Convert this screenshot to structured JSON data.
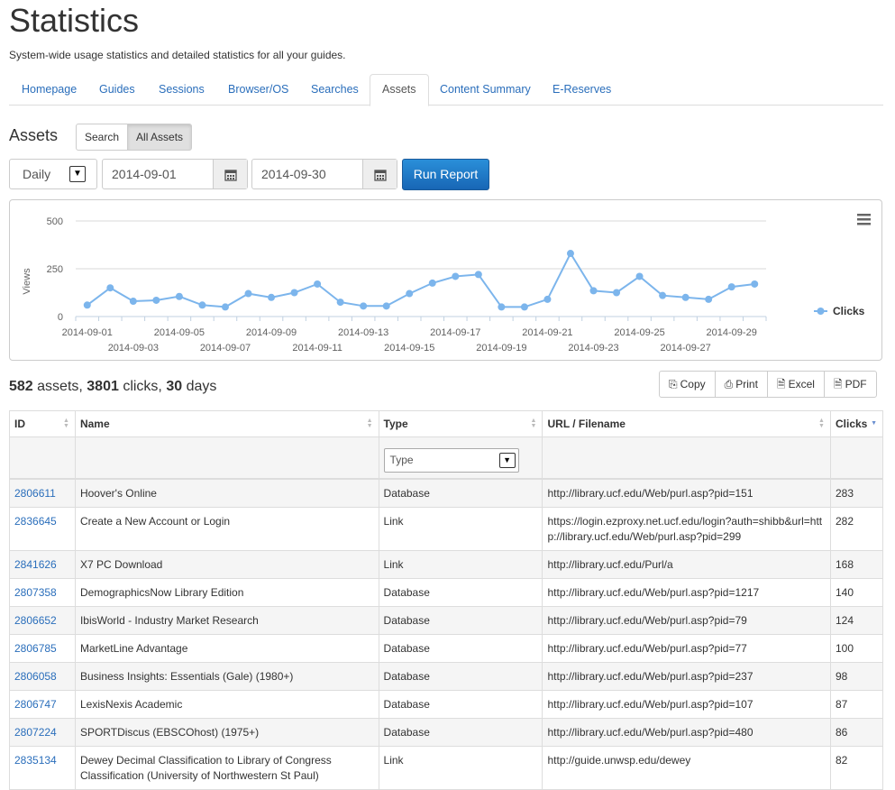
{
  "page": {
    "title": "Statistics",
    "subtitle": "System-wide usage statistics and detailed statistics for all your guides."
  },
  "tabs": [
    "Homepage",
    "Guides",
    "Sessions",
    "Browser/OS",
    "Searches",
    "Assets",
    "Content Summary",
    "E-Reserves"
  ],
  "active_tab": "Assets",
  "section": {
    "title": "Assets",
    "toggle": [
      "Search",
      "All Assets"
    ]
  },
  "filters": {
    "period": "Daily",
    "start_date": "2014-09-01",
    "end_date": "2014-09-30",
    "run_label": "Run Report"
  },
  "chart_data": {
    "type": "line",
    "ylabel": "Views",
    "ylim": [
      0,
      500
    ],
    "yticks": [
      0,
      250,
      500
    ],
    "legend": "Clicks",
    "x_labels_top": [
      "2014-09-01",
      "2014-09-05",
      "2014-09-09",
      "2014-09-13",
      "2014-09-17",
      "2014-09-21",
      "2014-09-25",
      "2014-09-29"
    ],
    "x_labels_bottom": [
      "2014-09-03",
      "2014-09-07",
      "2014-09-11",
      "2014-09-15",
      "2014-09-19",
      "2014-09-23",
      "2014-09-27"
    ],
    "x": [
      "2014-09-01",
      "2014-09-02",
      "2014-09-03",
      "2014-09-04",
      "2014-09-05",
      "2014-09-06",
      "2014-09-07",
      "2014-09-08",
      "2014-09-09",
      "2014-09-10",
      "2014-09-11",
      "2014-09-12",
      "2014-09-13",
      "2014-09-14",
      "2014-09-15",
      "2014-09-16",
      "2014-09-17",
      "2014-09-18",
      "2014-09-19",
      "2014-09-20",
      "2014-09-21",
      "2014-09-22",
      "2014-09-23",
      "2014-09-24",
      "2014-09-25",
      "2014-09-26",
      "2014-09-27",
      "2014-09-28",
      "2014-09-29",
      "2014-09-30"
    ],
    "series": [
      {
        "name": "Clicks",
        "values": [
          60,
          150,
          80,
          85,
          105,
          60,
          50,
          120,
          100,
          125,
          170,
          75,
          55,
          55,
          120,
          175,
          210,
          220,
          50,
          50,
          90,
          330,
          135,
          125,
          210,
          110,
          100,
          90,
          155,
          170
        ]
      }
    ],
    "color": "#7cb5ec",
    "legend_position": "right"
  },
  "summary": {
    "assets": "582",
    "assets_label": " assets, ",
    "clicks": "3801",
    "clicks_label": " clicks, ",
    "days": "30",
    "days_label": " days"
  },
  "exports": [
    "Copy",
    "Print",
    "Excel",
    "PDF"
  ],
  "table": {
    "headers": [
      "ID",
      "Name",
      "Type",
      "URL / Filename",
      "Clicks"
    ],
    "type_filter": "Type",
    "rows": [
      [
        "2806611",
        "Hoover's Online",
        "Database",
        "http://library.ucf.edu/Web/purl.asp?pid=151",
        "283"
      ],
      [
        "2836645",
        "Create a New Account or Login",
        "Link",
        "https://login.ezproxy.net.ucf.edu/login?auth=shibb&url=http://library.ucf.edu/Web/purl.asp?pid=299",
        "282"
      ],
      [
        "2841626",
        "X7 PC Download",
        "Link",
        "http://library.ucf.edu/Purl/a",
        "168"
      ],
      [
        "2807358",
        "DemographicsNow Library Edition",
        "Database",
        "http://library.ucf.edu/Web/purl.asp?pid=1217",
        "140"
      ],
      [
        "2806652",
        "IbisWorld - Industry Market Research",
        "Database",
        "http://library.ucf.edu/Web/purl.asp?pid=79",
        "124"
      ],
      [
        "2806785",
        "MarketLine Advantage",
        "Database",
        "http://library.ucf.edu/Web/purl.asp?pid=77",
        "100"
      ],
      [
        "2806058",
        "Business Insights: Essentials (Gale) (1980+)",
        "Database",
        "http://library.ucf.edu/Web/purl.asp?pid=237",
        "98"
      ],
      [
        "2806747",
        "LexisNexis Academic",
        "Database",
        "http://library.ucf.edu/Web/purl.asp?pid=107",
        "87"
      ],
      [
        "2807224",
        "SPORTDiscus (EBSCOhost) (1975+)",
        "Database",
        "http://library.ucf.edu/Web/purl.asp?pid=480",
        "86"
      ],
      [
        "2835134",
        "Dewey Decimal Classification to Library of Congress Classification (University of Northwestern St Paul)",
        "Link",
        "http://guide.unwsp.edu/dewey",
        "82"
      ]
    ]
  }
}
